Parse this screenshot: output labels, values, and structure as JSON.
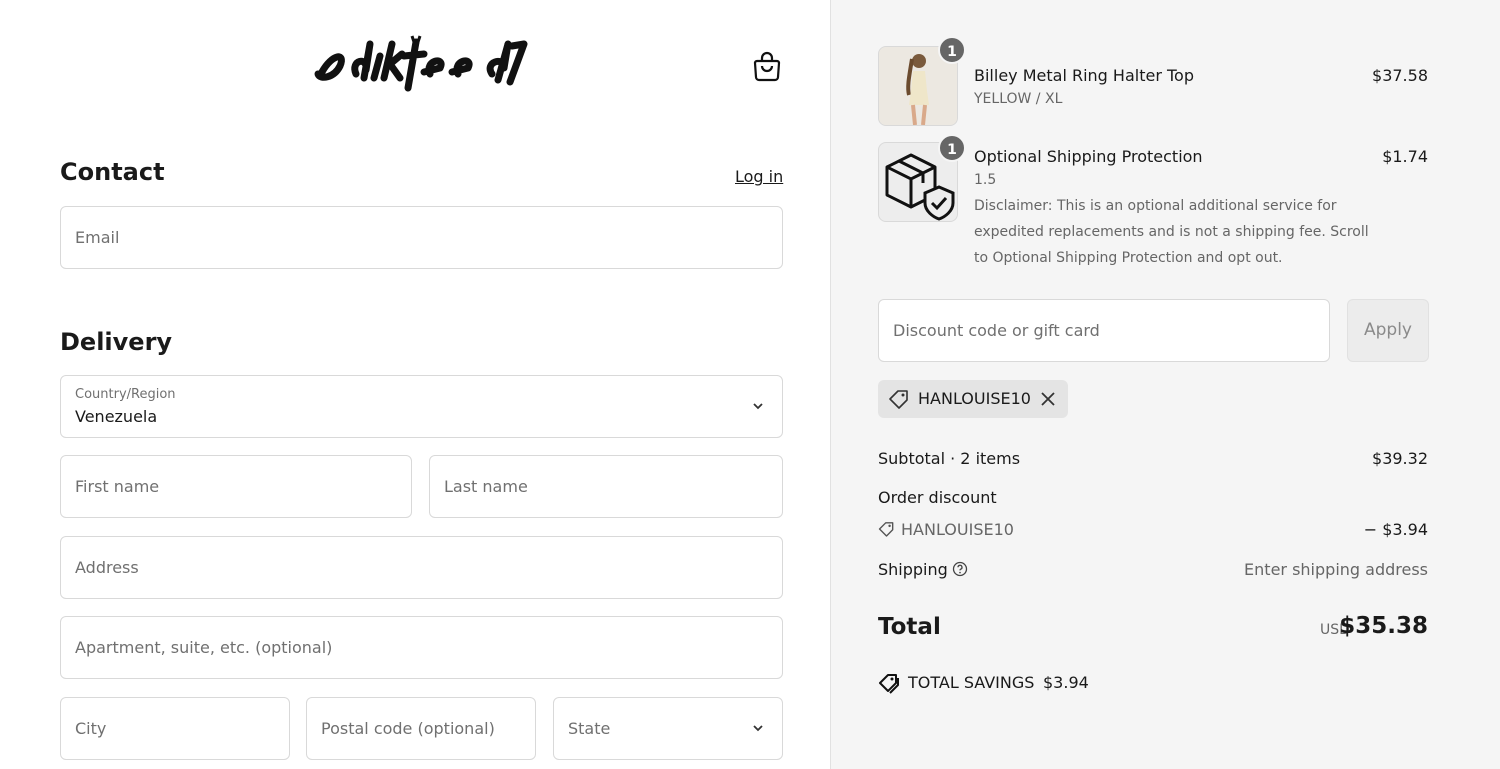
{
  "brand": {
    "logo_text": "edikted"
  },
  "contact": {
    "title": "Contact",
    "login_label": "Log in",
    "email_placeholder": "Email"
  },
  "delivery": {
    "title": "Delivery",
    "country_label": "Country/Region",
    "country_value": "Venezuela",
    "first_name_placeholder": "First name",
    "last_name_placeholder": "Last name",
    "address_placeholder": "Address",
    "apartment_placeholder": "Apartment, suite, etc. (optional)",
    "city_placeholder": "City",
    "postal_placeholder": "Postal code (optional)",
    "state_placeholder": "State"
  },
  "order": {
    "items": [
      {
        "title": "Billey Metal Ring Halter Top",
        "variant": "YELLOW / XL",
        "price": "$37.58",
        "qty": "1",
        "icon": "product-photo"
      },
      {
        "title": "Optional Shipping Protection",
        "variant": "1.5",
        "price": "$1.74",
        "qty": "1",
        "icon": "box-shield-icon",
        "disclaimer": "Disclaimer: This is an optional additional service for expedited replacements and is not a shipping fee. Scroll to Optional Shipping Protection and opt out."
      }
    ],
    "discount_placeholder": "Discount code or gift card",
    "apply_label": "Apply",
    "applied_code": "HANLOUISE10",
    "subtotal_label": "Subtotal · 2 items",
    "subtotal_value": "$39.32",
    "order_discount_label": "Order discount",
    "discount_code": "HANLOUISE10",
    "discount_value": "− $3.94",
    "shipping_label": "Shipping",
    "shipping_value": "Enter shipping address",
    "total_label": "Total",
    "currency": "USD",
    "total_value": "$35.38",
    "savings_label": "TOTAL SAVINGS",
    "savings_value": "$3.94"
  },
  "colors": {
    "sidebar_bg": "#f5f5f5",
    "badge": "#666666",
    "border": "#d9d9d9"
  }
}
